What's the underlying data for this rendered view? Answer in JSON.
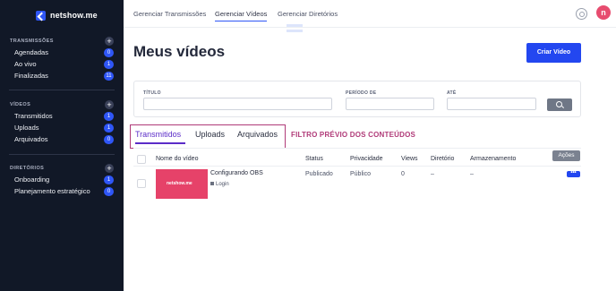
{
  "brand": {
    "name": "netshow.me"
  },
  "sidebar": {
    "sections": [
      {
        "title": "TRANSMISSÕES",
        "items": [
          {
            "label": "Agendadas",
            "count": "0"
          },
          {
            "label": "Ao vivo",
            "count": "1"
          },
          {
            "label": "Finalizadas",
            "count": "11"
          }
        ]
      },
      {
        "title": "VÍDEOS",
        "items": [
          {
            "label": "Transmitidos",
            "count": "1"
          },
          {
            "label": "Uploads",
            "count": "1"
          },
          {
            "label": "Arquivados",
            "count": "0"
          }
        ]
      },
      {
        "title": "DIRETÓRIOS",
        "items": [
          {
            "label": "Onboarding",
            "count": "1"
          },
          {
            "label": "Planejamento estratégico",
            "count": "0"
          }
        ]
      }
    ],
    "plus_glyph": "+"
  },
  "topnav": {
    "items": [
      "Gerenciar Transmissões",
      "Gerenciar Vídeos",
      "Gerenciar Diretórios"
    ],
    "active": "Gerenciar Vídeos",
    "avatar_letter": "n"
  },
  "main": {
    "title": "Meus vídeos",
    "create_button": "Criar Vídeo"
  },
  "filter": {
    "title_label": "TÍTULO",
    "period_label": "PERÍODO DE",
    "until_label": "ATÉ"
  },
  "tabs": {
    "items": [
      "Transmitidos",
      "Uploads",
      "Arquivados"
    ],
    "active": "Transmitidos",
    "annotation": "FILTRO PRÉVIO DOS CONTEÚDOS"
  },
  "table": {
    "actions_button": "Ações",
    "headers": [
      "Nome do vídeo",
      "Status",
      "Privacidade",
      "Views",
      "Diretório",
      "Armazenamento"
    ],
    "rows": [
      {
        "thumb_text": "netshow.me",
        "title": "Configurando OBS",
        "subtitle": "Login",
        "status": "Publicado",
        "privacy": "Público",
        "views": "0",
        "directory": "–",
        "storage": "–",
        "more": "•••"
      }
    ]
  },
  "colors": {
    "accent": "#2347f0",
    "sidebar_bg": "#111827",
    "annotation": "#b03a78",
    "tab_active": "#5b2cc8",
    "thumb": "#e64269"
  },
  "icons": [
    "gear-icon",
    "search-icon",
    "lock-icon",
    "more-icon",
    "plus-icon",
    "logo-icon"
  ]
}
